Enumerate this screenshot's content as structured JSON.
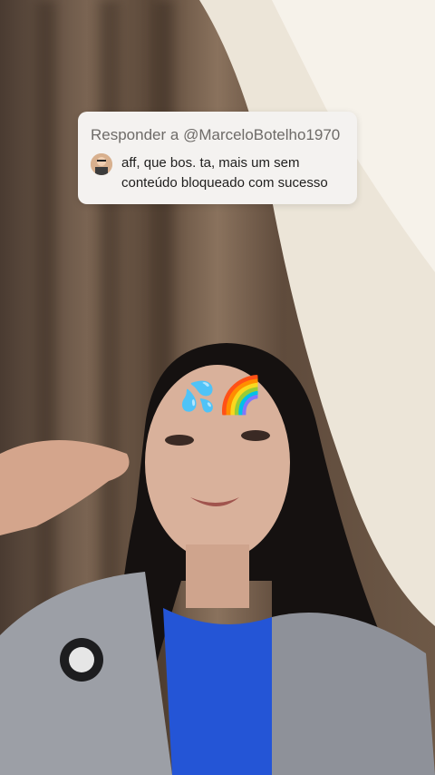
{
  "reply": {
    "header": "Responder a @MarceloBotelho1970",
    "comment": "aff, que bos. ta,  mais um sem conteúdo bloqueado com sucesso"
  },
  "stickers": [
    {
      "name": "sweat-droplets",
      "glyph": "💦"
    },
    {
      "name": "rainbow",
      "glyph": "🌈"
    }
  ]
}
